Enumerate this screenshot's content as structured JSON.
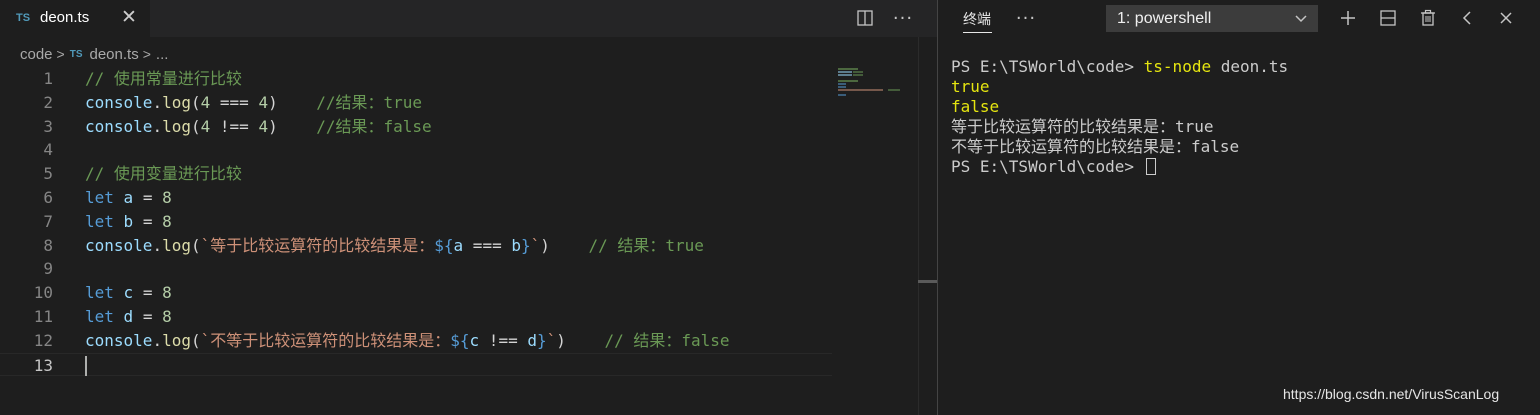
{
  "editor": {
    "tab": {
      "badge": "TS",
      "label": "deon.ts",
      "close": "✕"
    },
    "more_label": "···",
    "breadcrumb": {
      "root": "code",
      "sep": ">",
      "file_badge": "TS",
      "file": "deon.ts",
      "ellipsis": "..."
    },
    "lines": [
      {
        "n": "1",
        "tokens": [
          {
            "c": "c-comment",
            "t": "// 使用常量进行比较"
          }
        ]
      },
      {
        "n": "2",
        "tokens": [
          {
            "c": "c-var",
            "t": "console"
          },
          {
            "c": "c-op",
            "t": "."
          },
          {
            "c": "c-fn",
            "t": "log"
          },
          {
            "c": "c-op",
            "t": "("
          },
          {
            "c": "c-num",
            "t": "4"
          },
          {
            "c": "c-op",
            "t": " === "
          },
          {
            "c": "c-num",
            "t": "4"
          },
          {
            "c": "c-op",
            "t": ")    "
          },
          {
            "c": "c-comment",
            "t": "//结果：true"
          }
        ]
      },
      {
        "n": "3",
        "tokens": [
          {
            "c": "c-var",
            "t": "console"
          },
          {
            "c": "c-op",
            "t": "."
          },
          {
            "c": "c-fn",
            "t": "log"
          },
          {
            "c": "c-op",
            "t": "("
          },
          {
            "c": "c-num",
            "t": "4"
          },
          {
            "c": "c-op",
            "t": " !== "
          },
          {
            "c": "c-num",
            "t": "4"
          },
          {
            "c": "c-op",
            "t": ")    "
          },
          {
            "c": "c-comment",
            "t": "//结果：false"
          }
        ]
      },
      {
        "n": "4",
        "tokens": []
      },
      {
        "n": "5",
        "tokens": [
          {
            "c": "c-comment",
            "t": "// 使用变量进行比较"
          }
        ]
      },
      {
        "n": "6",
        "tokens": [
          {
            "c": "c-kw",
            "t": "let"
          },
          {
            "c": "c-op",
            "t": " "
          },
          {
            "c": "c-var",
            "t": "a"
          },
          {
            "c": "c-op",
            "t": " = "
          },
          {
            "c": "c-num",
            "t": "8"
          }
        ]
      },
      {
        "n": "7",
        "tokens": [
          {
            "c": "c-kw",
            "t": "let"
          },
          {
            "c": "c-op",
            "t": " "
          },
          {
            "c": "c-var",
            "t": "b"
          },
          {
            "c": "c-op",
            "t": " = "
          },
          {
            "c": "c-num",
            "t": "8"
          }
        ]
      },
      {
        "n": "8",
        "tokens": [
          {
            "c": "c-var",
            "t": "console"
          },
          {
            "c": "c-op",
            "t": "."
          },
          {
            "c": "c-fn",
            "t": "log"
          },
          {
            "c": "c-op",
            "t": "("
          },
          {
            "c": "c-str",
            "t": "`等于比较运算符的比较结果是："
          },
          {
            "c": "c-tmpl",
            "t": "${"
          },
          {
            "c": "c-var",
            "t": "a"
          },
          {
            "c": "c-op",
            "t": " === "
          },
          {
            "c": "c-var",
            "t": "b"
          },
          {
            "c": "c-tmpl",
            "t": "}"
          },
          {
            "c": "c-str",
            "t": "`"
          },
          {
            "c": "c-op",
            "t": ")    "
          },
          {
            "c": "c-comment",
            "t": "// 结果：true"
          }
        ]
      },
      {
        "n": "9",
        "tokens": []
      },
      {
        "n": "10",
        "tokens": [
          {
            "c": "c-kw",
            "t": "let"
          },
          {
            "c": "c-op",
            "t": " "
          },
          {
            "c": "c-var",
            "t": "c"
          },
          {
            "c": "c-op",
            "t": " = "
          },
          {
            "c": "c-num",
            "t": "8"
          }
        ]
      },
      {
        "n": "11",
        "tokens": [
          {
            "c": "c-kw",
            "t": "let"
          },
          {
            "c": "c-op",
            "t": " "
          },
          {
            "c": "c-var",
            "t": "d"
          },
          {
            "c": "c-op",
            "t": " = "
          },
          {
            "c": "c-num",
            "t": "8"
          }
        ]
      },
      {
        "n": "12",
        "tokens": [
          {
            "c": "c-var",
            "t": "console"
          },
          {
            "c": "c-op",
            "t": "."
          },
          {
            "c": "c-fn",
            "t": "log"
          },
          {
            "c": "c-op",
            "t": "("
          },
          {
            "c": "c-str",
            "t": "`不等于比较运算符的比较结果是："
          },
          {
            "c": "c-tmpl",
            "t": "${"
          },
          {
            "c": "c-var",
            "t": "c"
          },
          {
            "c": "c-op",
            "t": " !== "
          },
          {
            "c": "c-var",
            "t": "d"
          },
          {
            "c": "c-tmpl",
            "t": "}"
          },
          {
            "c": "c-str",
            "t": "`"
          },
          {
            "c": "c-op",
            "t": ")    "
          },
          {
            "c": "c-comment",
            "t": "// 结果：false"
          }
        ]
      },
      {
        "n": "13",
        "tokens": [],
        "current": true
      }
    ]
  },
  "terminal": {
    "tab_label": "终端",
    "more_label": "···",
    "shell_select": "1: powershell",
    "output": [
      {
        "prompt": "PS E:\\TSWorld\\code> ",
        "cmd": "ts-node",
        "rest": " deon.ts"
      },
      {
        "yellow": "true"
      },
      {
        "yellow": "false"
      },
      {
        "text": "等于比较运算符的比较结果是：true"
      },
      {
        "text": "不等于比较运算符的比较结果是：false"
      },
      {
        "prompt": "PS E:\\TSWorld\\code> ",
        "cursor": true
      }
    ]
  },
  "watermark": "https://blog.csdn.net/VirusScanLog",
  "colors": {
    "accent_ts": "#519aba",
    "terminal_command": "#e5e510",
    "background": "#1e1e1e"
  }
}
